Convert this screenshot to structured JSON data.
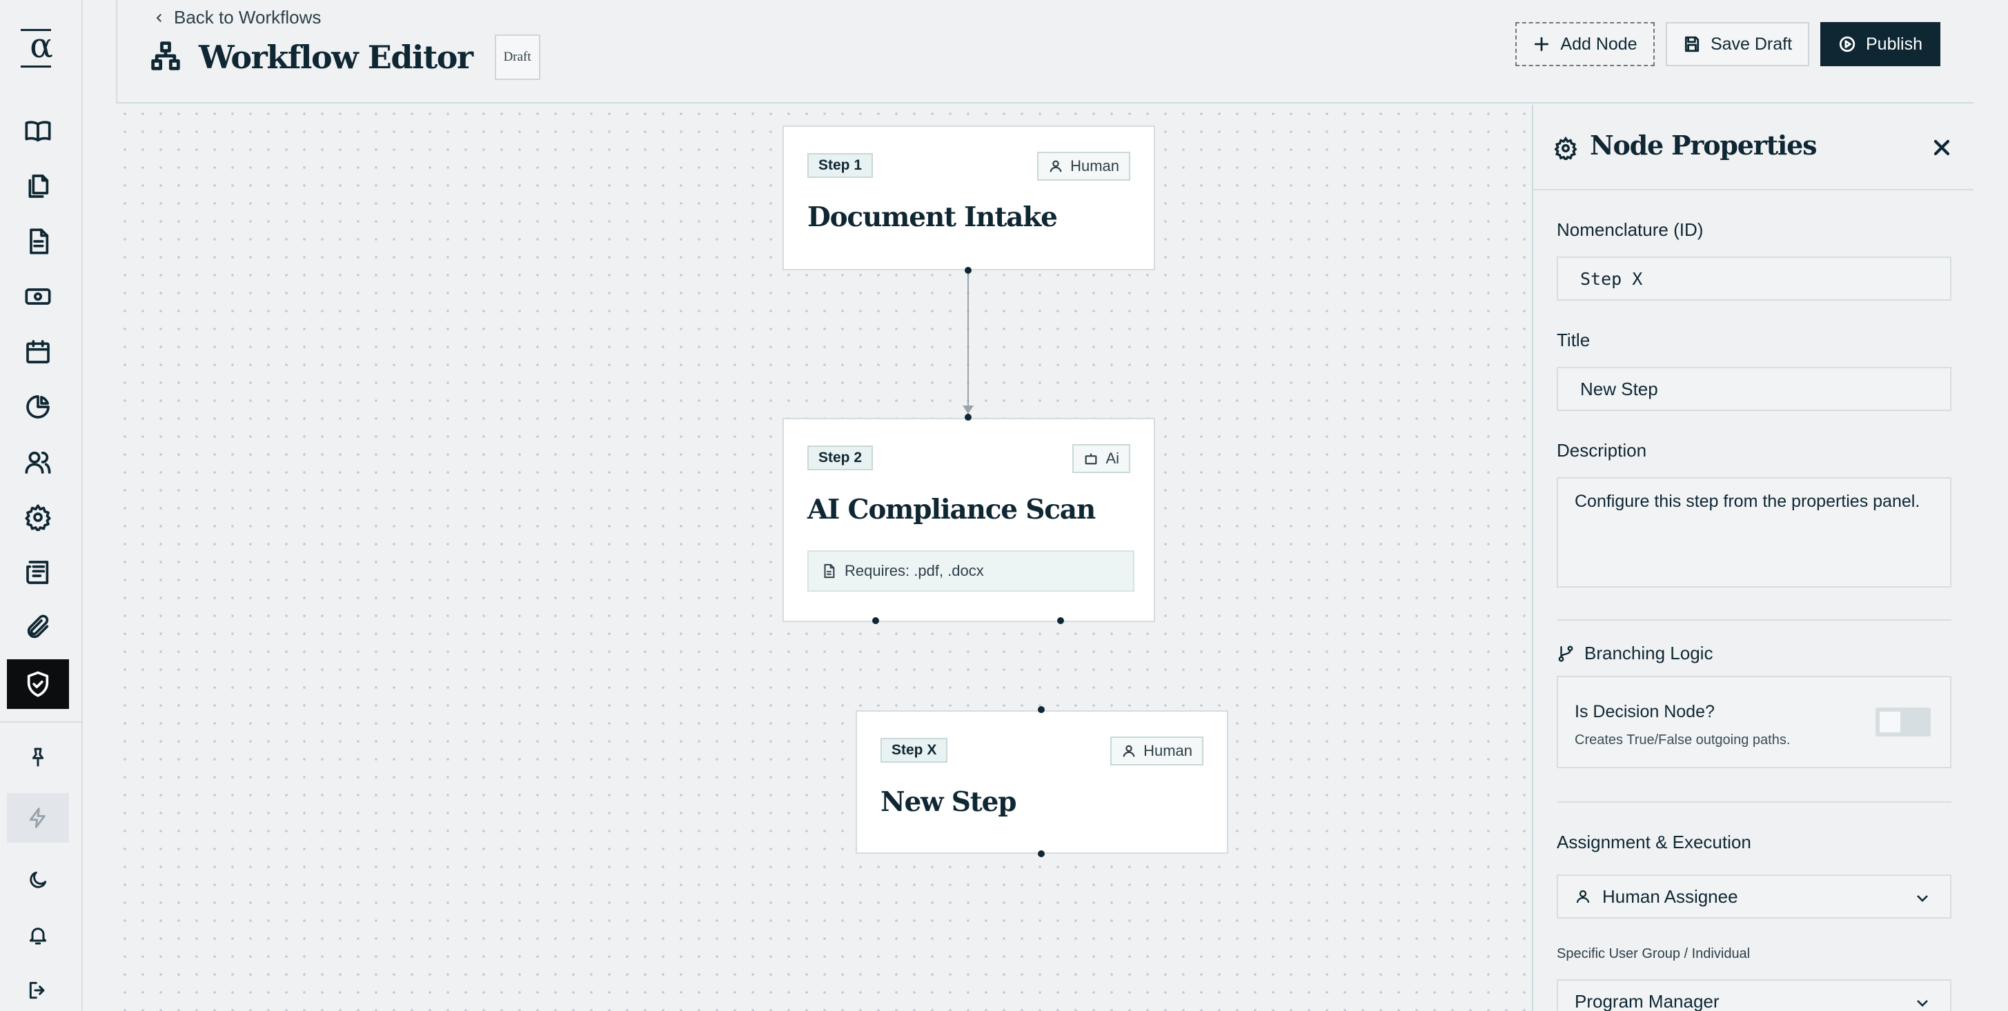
{
  "header": {
    "back_label": "Back to Workflows",
    "title": "Workflow Editor",
    "status_badge": "Draft",
    "add_node_label": "Add Node",
    "save_draft_label": "Save Draft",
    "publish_label": "Publish"
  },
  "sidebar": {
    "logo": "α",
    "items": [
      {
        "icon": "book-icon"
      },
      {
        "icon": "files-icon"
      },
      {
        "icon": "document-icon"
      },
      {
        "icon": "cash-icon"
      },
      {
        "icon": "calendar-icon"
      },
      {
        "icon": "pie-chart-icon"
      },
      {
        "icon": "users-icon"
      },
      {
        "icon": "gear-icon"
      },
      {
        "icon": "newspaper-icon"
      },
      {
        "icon": "paperclip-icon"
      },
      {
        "icon": "shield-check-icon",
        "active": true
      }
    ],
    "bottom_items": [
      {
        "icon": "pin-icon"
      },
      {
        "icon": "lightning-icon"
      },
      {
        "icon": "moon-icon"
      },
      {
        "icon": "bell-icon"
      },
      {
        "icon": "logout-icon"
      }
    ]
  },
  "canvas": {
    "nodes": [
      {
        "step": "Step 1",
        "type": "Human",
        "title": "Document Intake"
      },
      {
        "step": "Step 2",
        "type": "Ai",
        "title": "AI Compliance Scan",
        "requirement": "Requires: .pdf, .docx"
      },
      {
        "step": "Step X",
        "type": "Human",
        "title": "New Step"
      }
    ]
  },
  "panel": {
    "title": "Node Properties",
    "nomenclature_label": "Nomenclature (ID)",
    "nomenclature_value": "Step X",
    "title_label": "Title",
    "title_value": "New Step",
    "description_label": "Description",
    "description_value": "Configure this step from the properties panel.",
    "branching_label": "Branching Logic",
    "decision_title": "Is Decision Node?",
    "decision_subtitle": "Creates True/False outgoing paths.",
    "decision_enabled": false,
    "assignment_label": "Assignment & Execution",
    "assignee_value": "Human Assignee",
    "group_label": "Specific User Group / Individual",
    "group_value": "Program Manager"
  },
  "colors": {
    "primary": "#0f2733",
    "background": "#eff1f3",
    "active_rail": "#0b0d0e",
    "tag_background": "#e9f2f2"
  }
}
